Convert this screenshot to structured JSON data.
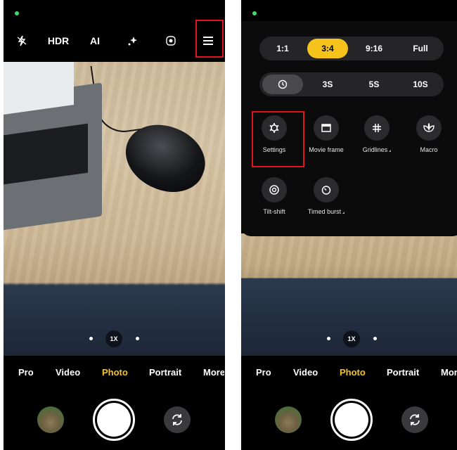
{
  "left_screen": {
    "toolbar": {
      "hdr_label": "HDR",
      "ai_label": "AI"
    },
    "zoom_label": "1X",
    "modes": [
      "Pro",
      "Video",
      "Photo",
      "Portrait",
      "More"
    ],
    "active_mode": "Photo"
  },
  "right_screen": {
    "aspect_options": [
      "1:1",
      "3:4",
      "9:16",
      "Full"
    ],
    "selected_aspect": "3:4",
    "timer_options": [
      "3S",
      "5S",
      "10S"
    ],
    "settings_grid": [
      {
        "label": "Settings",
        "icon": "gear-icon"
      },
      {
        "label": "Movie frame",
        "icon": "movie-frame-icon"
      },
      {
        "label": "Gridlines",
        "icon": "grid-icon"
      },
      {
        "label": "Macro",
        "icon": "flower-icon"
      },
      {
        "label": "Tilt-shift",
        "icon": "target-icon"
      },
      {
        "label": "Timed burst",
        "icon": "timer-icon"
      }
    ],
    "zoom_label": "1X",
    "modes": [
      "Pro",
      "Video",
      "Photo",
      "Portrait",
      "More"
    ],
    "active_mode": "Photo"
  },
  "colors": {
    "accent": "#f6c21c",
    "highlight": "#e0141e"
  }
}
